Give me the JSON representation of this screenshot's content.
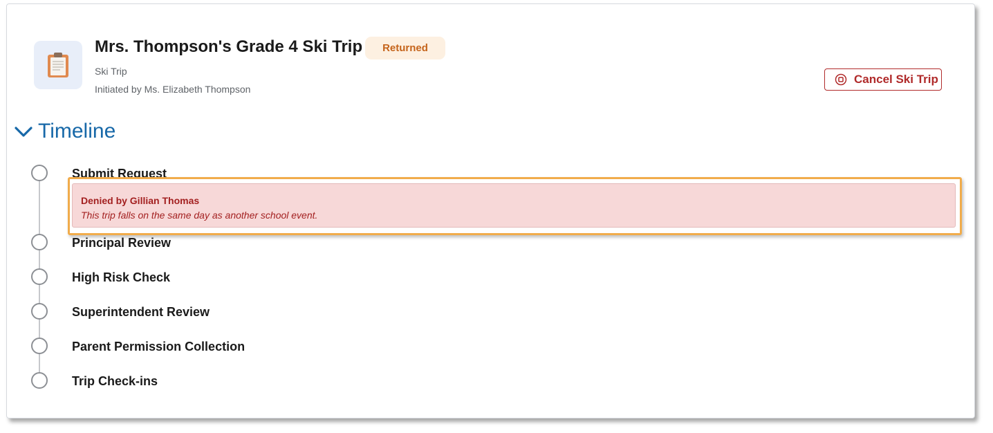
{
  "header": {
    "icon": "clipboard-icon",
    "title": "Mrs. Thompson's Grade 4 Ski Trip",
    "status": "Returned",
    "subtitle": "Ski Trip",
    "initiated_by": "Initiated by Ms. Elizabeth Thompson",
    "cancel_label": "Cancel Ski Trip"
  },
  "timeline": {
    "label": "Timeline",
    "denial": {
      "title": "Denied by Gillian Thomas",
      "reason": "This trip falls on the same day as another school event."
    },
    "steps": [
      {
        "label": "Submit Request"
      },
      {
        "label": "Principal Review"
      },
      {
        "label": "High Risk Check"
      },
      {
        "label": "Superintendent Review"
      },
      {
        "label": "Parent Permission Collection"
      },
      {
        "label": "Trip Check-ins"
      }
    ]
  },
  "colors": {
    "accent": "#1768a8",
    "danger": "#b02a2a",
    "status_bg": "#fdf0e1",
    "status_text": "#c5641b",
    "denial_bg": "#f7d8d8",
    "highlight": "#f1ac4b"
  }
}
